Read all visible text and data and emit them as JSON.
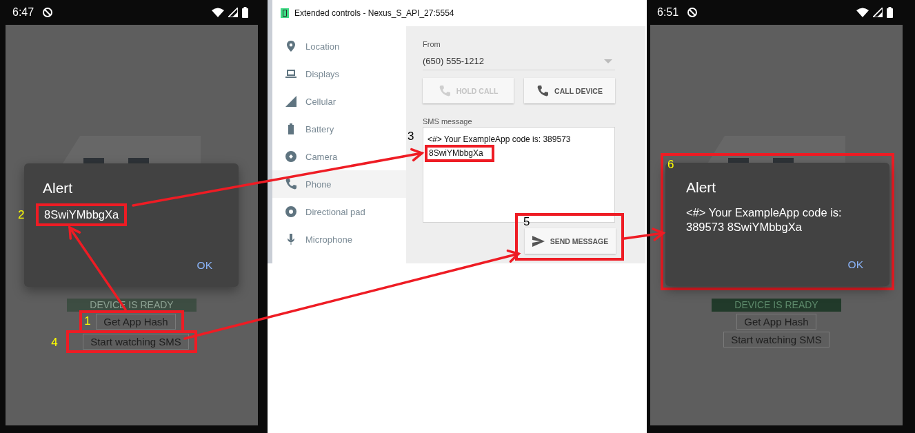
{
  "phones": [
    {
      "status_bar": {
        "time": "6:47"
      },
      "app": {
        "status": "DEVICE IS READY",
        "buttons": [
          {
            "label": "Get App Hash",
            "callout": "1"
          },
          {
            "label": "Start watching SMS",
            "callout": "4"
          }
        ]
      },
      "dialog": {
        "title": "Alert",
        "message": "8SwiYMbbgXa",
        "message_callout": "2",
        "button": "OK"
      }
    },
    {
      "status_bar": {
        "time": "6:51"
      },
      "app": {
        "status": "DEVICE IS READY",
        "buttons": [
          {
            "label": "Get App Hash"
          },
          {
            "label": "Start watching SMS"
          }
        ]
      },
      "dialog": {
        "title": "Alert",
        "message": "<#> Your ExampleApp code is: 389573 8SwiYMbbgXa",
        "callout": "6",
        "button": "OK"
      }
    }
  ],
  "emulator": {
    "window": {
      "title": "Extended controls - Nexus_S_API_27:5554"
    },
    "sidebar": {
      "items": [
        {
          "label": "Location",
          "selected": false
        },
        {
          "label": "Displays",
          "selected": false
        },
        {
          "label": "Cellular",
          "selected": false
        },
        {
          "label": "Battery",
          "selected": false
        },
        {
          "label": "Camera",
          "selected": false
        },
        {
          "label": "Phone",
          "selected": true
        },
        {
          "label": "Directional pad",
          "selected": false
        },
        {
          "label": "Microphone",
          "selected": false
        }
      ]
    },
    "from": {
      "label": "From",
      "value": "(650) 555-1212"
    },
    "buttons": [
      {
        "label": "HOLD CALL",
        "disabled": true
      },
      {
        "label": "CALL DEVICE",
        "disabled": false
      }
    ],
    "sms": {
      "label": "SMS message",
      "lines": [
        {
          "text": "<#> Your ExampleApp code is: 389573"
        },
        {
          "text": "8SwiYMbbgXa",
          "callout": "3"
        }
      ]
    },
    "send": {
      "label": "SEND MESSAGE",
      "callout": "5"
    }
  }
}
